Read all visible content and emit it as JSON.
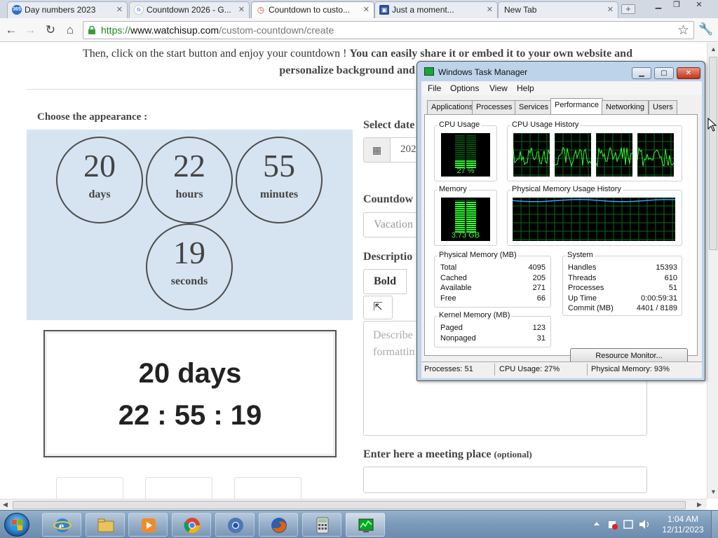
{
  "browser": {
    "tabs": [
      {
        "title": "Day numbers 2023",
        "icon_text": "365",
        "icon_color": "#2f6fd1"
      },
      {
        "title": "Countdown 2026 - G...",
        "icon_text": "G",
        "icon_color": "#4285f4"
      },
      {
        "title": "Countdown to custo...",
        "icon_text": "◷",
        "icon_color": "#e0443a"
      },
      {
        "title": "Just a moment...",
        "icon_text": "▣",
        "icon_color": "#2b4f9c"
      },
      {
        "title": "New Tab",
        "icon_text": "",
        "icon_color": "#cccccc"
      }
    ],
    "url_scheme": "https://",
    "url_host": "www.watchisup.com",
    "url_path": "/custom-countdown/create"
  },
  "page": {
    "intro_plain": "Then, click on the start button and enjoy your countdown ! ",
    "intro_bold_1": "You can easily share it or embed it to your own website and",
    "intro_bold_2": "personalize background and text",
    "appearance_heading": "Choose the appearance :",
    "select_date_heading": "Select date",
    "date_value": "202",
    "countdown_heading": "Countdow",
    "countdown_placeholder": "Vacation",
    "description_heading": "Descriptio",
    "bold_label": "Bold",
    "description_placeholder_1": "Describe",
    "description_placeholder_2": "formattin",
    "meeting_place_heading": "Enter here a meeting place",
    "meeting_place_optional": "(optional)",
    "circles": [
      {
        "value": "20",
        "label": "days"
      },
      {
        "value": "22",
        "label": "hours"
      },
      {
        "value": "55",
        "label": "minutes"
      },
      {
        "value": "19",
        "label": "seconds"
      }
    ],
    "digital_line1": "20 days",
    "digital_line2": "22 : 55 : 19",
    "appearance_bg": "#d6e4f1"
  },
  "task_manager": {
    "title": "Windows Task Manager",
    "menu": [
      "File",
      "Options",
      "View",
      "Help"
    ],
    "tabs": [
      "Applications",
      "Processes",
      "Services",
      "Performance",
      "Networking",
      "Users"
    ],
    "active_tab": "Performance",
    "cpu_usage_label": "CPU Usage",
    "cpu_usage_value": "27 %",
    "cpu_usage_fraction": 0.27,
    "cpu_history_label": "CPU Usage History",
    "memory_label": "Memory",
    "memory_value": "3.73 GB",
    "memory_fraction": 0.93,
    "phys_history_label": "Physical Memory Usage History",
    "physical_memory": {
      "title": "Physical Memory (MB)",
      "rows": [
        {
          "k": "Total",
          "v": "4095"
        },
        {
          "k": "Cached",
          "v": "205"
        },
        {
          "k": "Available",
          "v": "271"
        },
        {
          "k": "Free",
          "v": "66"
        }
      ]
    },
    "kernel_memory": {
      "title": "Kernel Memory (MB)",
      "rows": [
        {
          "k": "Paged",
          "v": "123"
        },
        {
          "k": "Nonpaged",
          "v": "31"
        }
      ]
    },
    "system": {
      "title": "System",
      "rows": [
        {
          "k": "Handles",
          "v": "15393"
        },
        {
          "k": "Threads",
          "v": "610"
        },
        {
          "k": "Processes",
          "v": "51"
        },
        {
          "k": "Up Time",
          "v": "0:00:59:31"
        },
        {
          "k": "Commit (MB)",
          "v": "4401 / 8189"
        }
      ]
    },
    "resource_monitor_label": "Resource Monitor...",
    "status": {
      "processes": "Processes: 51",
      "cpu": "CPU Usage: 27%",
      "memory": "Physical Memory: 93%"
    }
  },
  "taskbar": {
    "apps": [
      "internet-explorer-icon",
      "file-explorer-icon",
      "media-player-icon",
      "chrome-icon",
      "chrome-alt-icon",
      "firefox-icon",
      "calculator-icon",
      "task-manager-icon"
    ],
    "time": "1:04 AM",
    "date": "12/11/2023"
  },
  "colors": {
    "graph_green": "#33ff33",
    "graph_grid": "#0a6b1e",
    "url_green": "#1a8a1a"
  }
}
